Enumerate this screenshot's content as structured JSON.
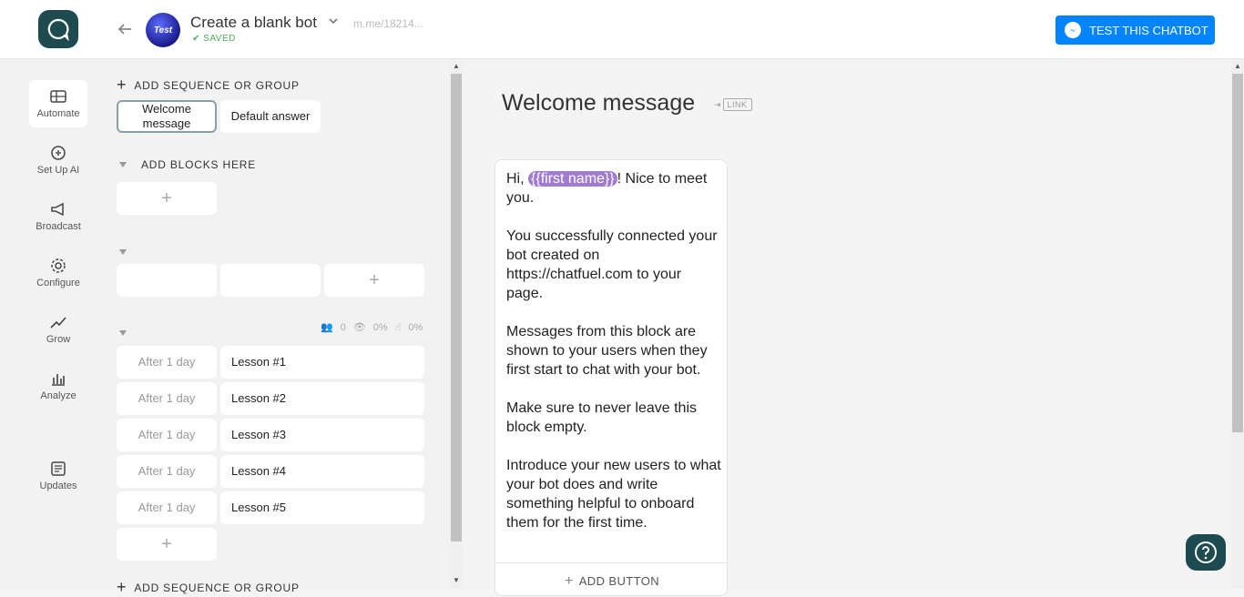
{
  "header": {
    "bot_title": "Create a blank bot",
    "saved": "SAVED",
    "bot_link": "m.me/18214...",
    "test_button": "TEST THIS CHATBOT",
    "avatar_text": "Test"
  },
  "nav": {
    "items": [
      {
        "label": "Automate"
      },
      {
        "label": "Set Up AI"
      },
      {
        "label": "Broadcast"
      },
      {
        "label": "Configure"
      },
      {
        "label": "Grow"
      },
      {
        "label": "Analyze"
      },
      {
        "label": "Updates"
      }
    ]
  },
  "sidebar": {
    "add_sequence": "ADD SEQUENCE OR GROUP",
    "welcome_block": "Welcome message",
    "default_block": "Default answer",
    "add_blocks": "ADD BLOCKS HERE",
    "stats": {
      "users": "0",
      "seen": "0%",
      "clicked": "0%"
    },
    "sequence": [
      {
        "delay": "After 1 day",
        "lesson": "Lesson #1"
      },
      {
        "delay": "After 1 day",
        "lesson": "Lesson #2"
      },
      {
        "delay": "After 1 day",
        "lesson": "Lesson #3"
      },
      {
        "delay": "After 1 day",
        "lesson": "Lesson #4"
      },
      {
        "delay": "After 1 day",
        "lesson": "Lesson #5"
      }
    ],
    "add_sequence_bottom": "ADD SEQUENCE OR GROUP"
  },
  "editor": {
    "title": "Welcome message",
    "link_badge": "LINK",
    "greeting_prefix": "Hi, ",
    "first_name_var": "{{first name}}",
    "greeting_suffix": "! Nice to meet you.",
    "body": "You successfully connected your bot created on https://chatfuel.com to your page.\n\nMessages from this block are shown to your users when they first start to chat with your bot.\n\nMake sure to never leave this block empty.\n\nIntroduce your new users to what your bot does and write something helpful to onboard them for the first time.",
    "add_button": "ADD BUTTON"
  },
  "colors": {
    "brand": "#1d4b4f",
    "messenger_blue": "#0084ff",
    "saved_green": "#4caf50",
    "variable_purple": "#a07bd0"
  }
}
